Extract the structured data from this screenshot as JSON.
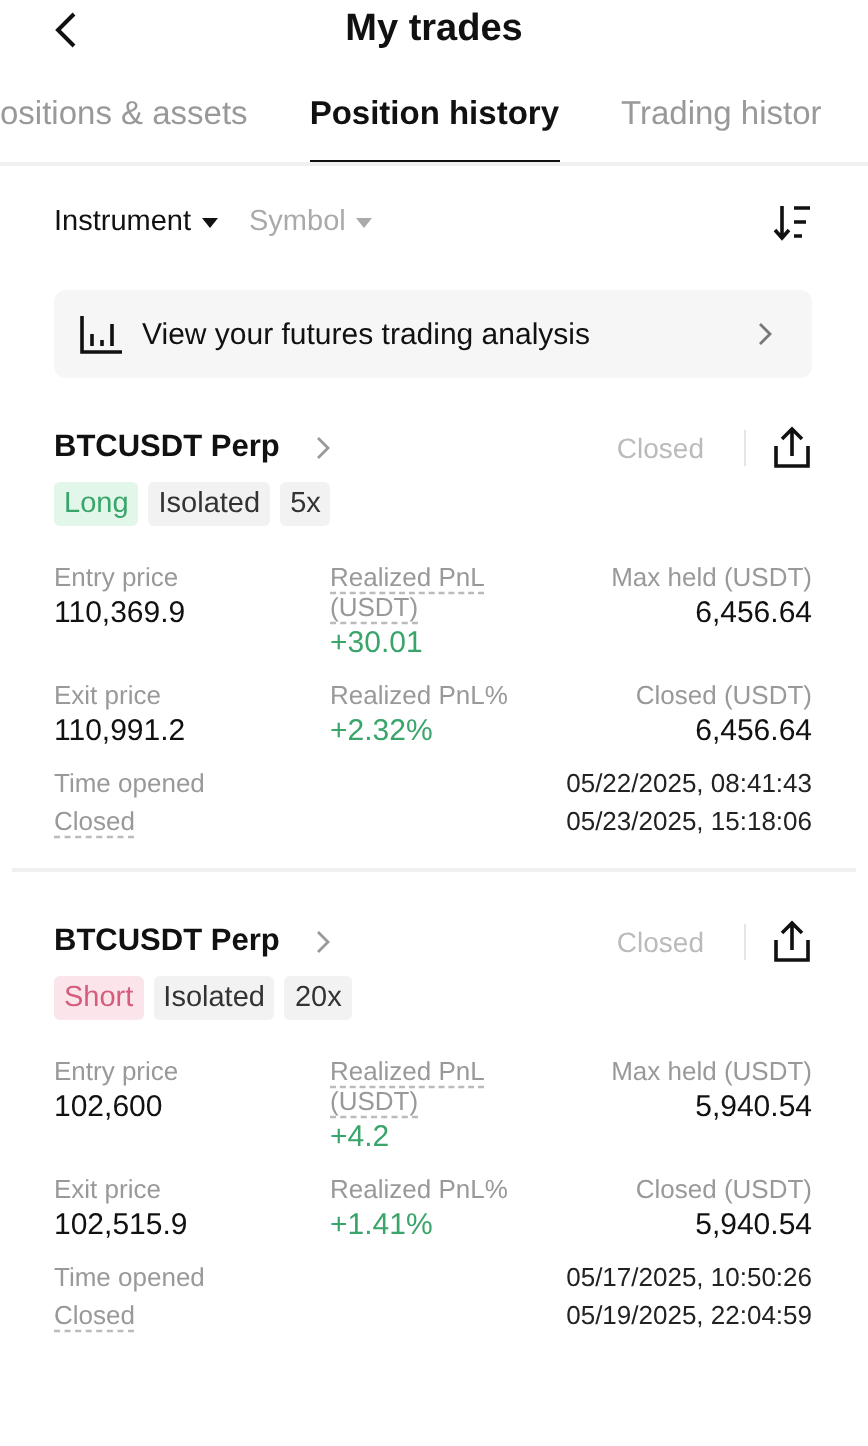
{
  "header": {
    "title": "My trades"
  },
  "tabs": [
    {
      "label": "ositions & assets",
      "selected": false
    },
    {
      "label": "Position history",
      "selected": true
    },
    {
      "label": "Trading histor",
      "selected": false
    }
  ],
  "filters": [
    {
      "label": "Instrument",
      "active": true
    },
    {
      "label": "Symbol",
      "active": false
    }
  ],
  "analysis_banner": {
    "label": "View your futures trading analysis"
  },
  "positions": [
    {
      "symbol": "BTCUSDT Perp",
      "status": "Closed",
      "tags": [
        {
          "label": "Long",
          "kind": "long"
        },
        {
          "label": "Isolated",
          "kind": "plain"
        },
        {
          "label": "5x",
          "kind": "plain"
        }
      ],
      "stats": [
        {
          "label": "Entry price",
          "value": "110,369.9",
          "dotted": false,
          "positive": false
        },
        {
          "label": "Realized PnL (USDT)",
          "value": "+30.01",
          "dotted": true,
          "positive": true
        },
        {
          "label": "Max held (USDT)",
          "value": "6,456.64",
          "dotted": false,
          "positive": false
        },
        {
          "label": "Exit price",
          "value": "110,991.2",
          "dotted": false,
          "positive": false
        },
        {
          "label": "Realized PnL%",
          "value": "+2.32%",
          "dotted": false,
          "positive": true
        },
        {
          "label": "Closed (USDT)",
          "value": "6,456.64",
          "dotted": false,
          "positive": false
        }
      ],
      "times": [
        {
          "label": "Time opened",
          "value": "05/22/2025, 08:41:43",
          "dotted": false
        },
        {
          "label": "Closed",
          "value": "05/23/2025, 15:18:06",
          "dotted": true
        }
      ]
    },
    {
      "symbol": "BTCUSDT Perp",
      "status": "Closed",
      "tags": [
        {
          "label": "Short",
          "kind": "short"
        },
        {
          "label": "Isolated",
          "kind": "plain"
        },
        {
          "label": "20x",
          "kind": "plain"
        }
      ],
      "stats": [
        {
          "label": "Entry price",
          "value": "102,600",
          "dotted": false,
          "positive": false
        },
        {
          "label": "Realized PnL (USDT)",
          "value": "+4.2",
          "dotted": true,
          "positive": true
        },
        {
          "label": "Max held (USDT)",
          "value": "5,940.54",
          "dotted": false,
          "positive": false
        },
        {
          "label": "Exit price",
          "value": "102,515.9",
          "dotted": false,
          "positive": false
        },
        {
          "label": "Realized PnL%",
          "value": "+1.41%",
          "dotted": false,
          "positive": true
        },
        {
          "label": "Closed (USDT)",
          "value": "5,940.54",
          "dotted": false,
          "positive": false
        }
      ],
      "times": [
        {
          "label": "Time opened",
          "value": "05/17/2025, 10:50:26",
          "dotted": false
        },
        {
          "label": "Closed",
          "value": "05/19/2025, 22:04:59",
          "dotted": true
        }
      ]
    }
  ]
}
